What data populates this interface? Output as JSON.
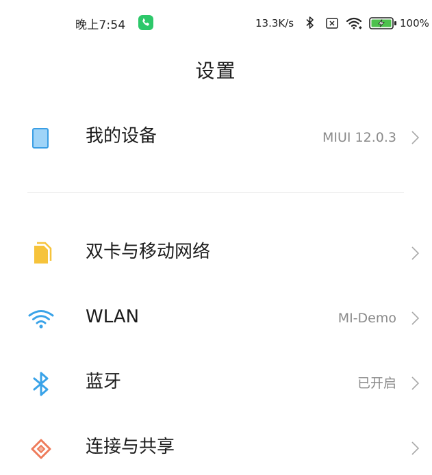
{
  "status_bar": {
    "time": "晚上7:54",
    "speed": "13.3K/s",
    "battery_percent": "100%"
  },
  "header": {
    "title": "设置"
  },
  "settings": {
    "my_device": {
      "label": "我的设备",
      "value": "MIUI 12.0.3",
      "icon": "device-icon"
    },
    "sim_network": {
      "label": "双卡与移动网络",
      "value": "",
      "icon": "sim-card-icon"
    },
    "wlan": {
      "label": "WLAN",
      "value": "MI-Demo",
      "icon": "wifi-icon"
    },
    "bluetooth": {
      "label": "蓝牙",
      "value": "已开启",
      "icon": "bluetooth-icon"
    },
    "connection_sharing": {
      "label": "连接与共享",
      "value": "",
      "icon": "connection-share-icon"
    }
  },
  "colors": {
    "device_icon": "#9fd4f8",
    "sim_icon": "#f6c33b",
    "wifi_icon": "#3aa3e8",
    "bluetooth_icon": "#3aa3e8",
    "share_icon": "#ee7b5a",
    "phone_badge": "#2dc86a"
  }
}
